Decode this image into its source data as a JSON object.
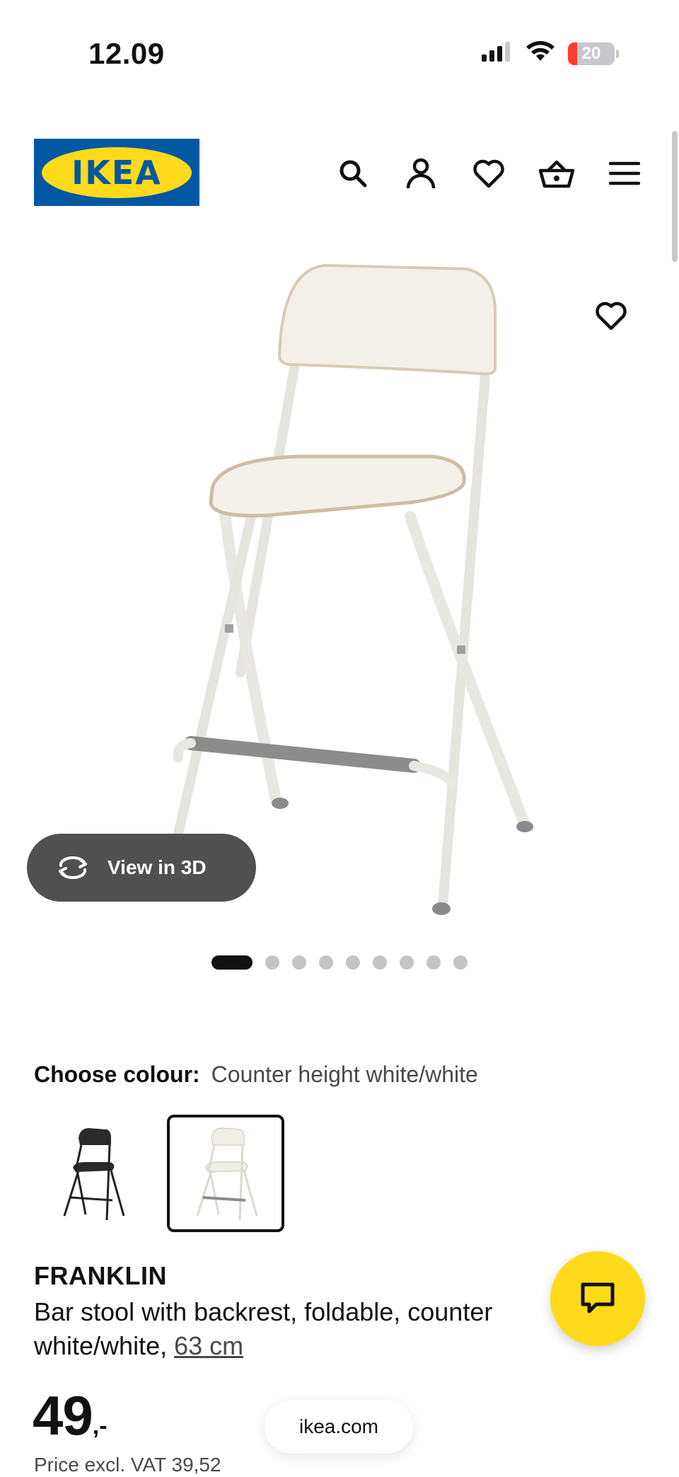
{
  "status_bar": {
    "time": "12.09",
    "battery_level": "20",
    "battery_color": "#ff3b30",
    "icons": [
      "signal-icon",
      "wifi-icon",
      "battery-icon"
    ]
  },
  "header": {
    "logo_text": "IKEA",
    "brand_colors": {
      "blue": "#0058a3",
      "yellow": "#ffda1a"
    },
    "icons": [
      "search-icon",
      "account-icon",
      "heart-icon",
      "basket-icon",
      "menu-icon"
    ]
  },
  "gallery": {
    "view_3d_label": "View in 3D",
    "image_count": 9,
    "active_index": 0,
    "favourite_icon": "heart-icon"
  },
  "colour": {
    "label": "Choose colour:",
    "selected_value": "Counter height white/white",
    "swatches": [
      {
        "name": "black",
        "selected": false
      },
      {
        "name": "white",
        "selected": true
      }
    ]
  },
  "product": {
    "name": "FRANKLIN",
    "description": "Bar stool with backrest, foldable, counter white/white, ",
    "size_link": "63 cm",
    "price_integer": "49",
    "price_suffix": ",-",
    "price_excl_vat": "Price excl. VAT 39,52"
  },
  "chat": {
    "icon": "chat-icon"
  },
  "browser": {
    "url": "ikea.com"
  }
}
